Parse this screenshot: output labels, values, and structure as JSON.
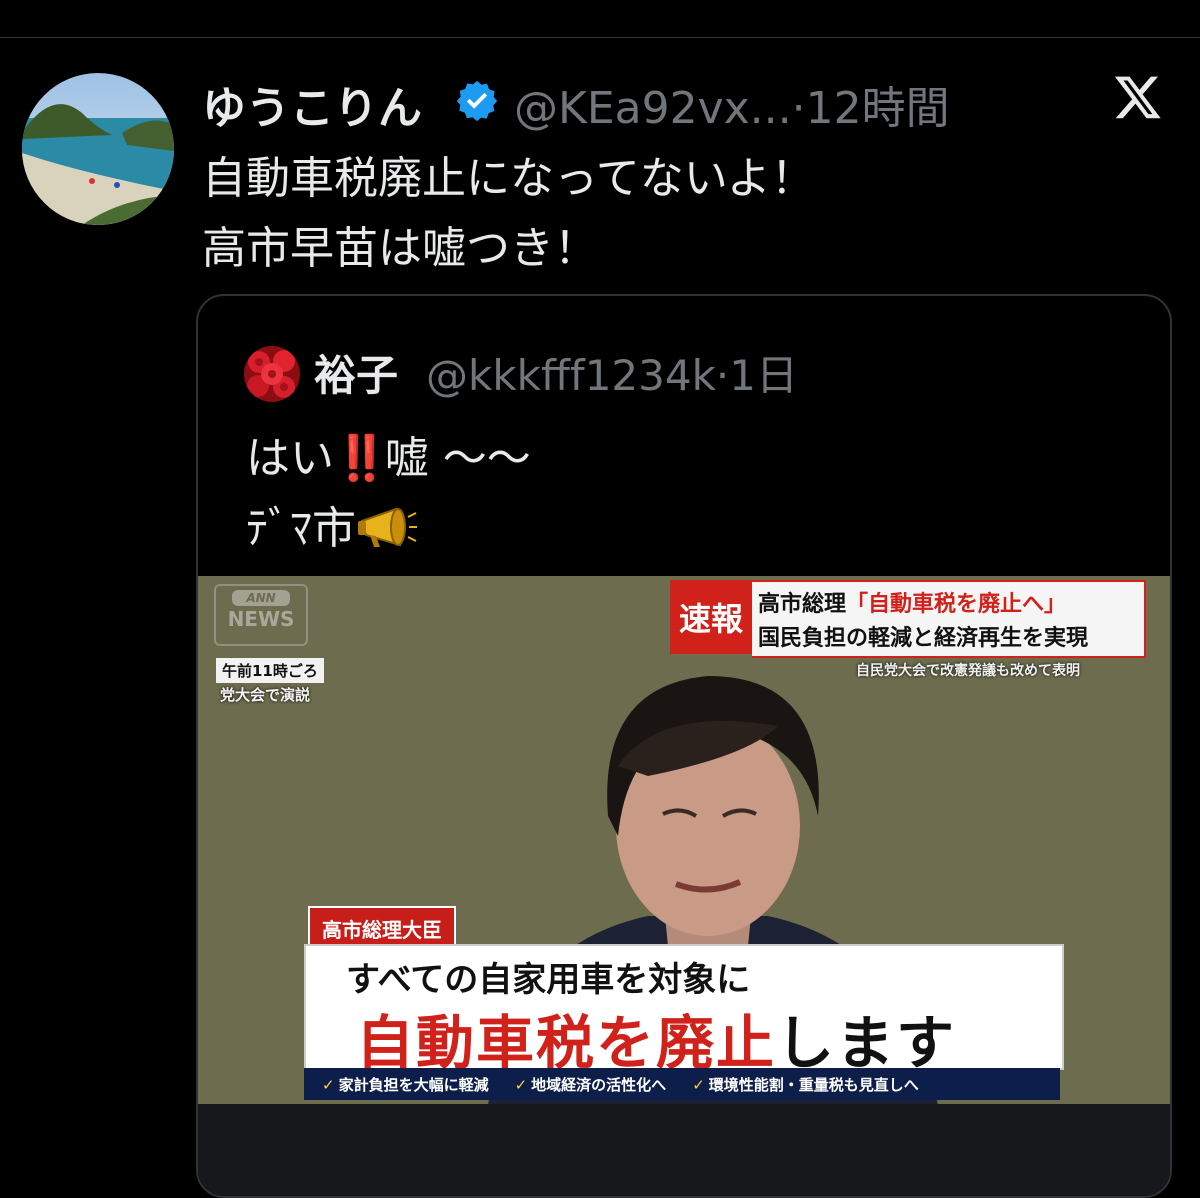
{
  "tweet": {
    "display_name": "ゆうこりん",
    "handle_time": "@KEa92vx...·12時間",
    "text_line1": "自動車税廃止になってないよ！",
    "text_line2": "高市早苗は嘘つき！"
  },
  "quoted": {
    "display_name": "裕子",
    "handle_time": "@kkkfff1234k·1日",
    "text_line1_a": "はい",
    "text_line1_b": "‼️",
    "text_line1_c": "嘘 〜〜",
    "text_line2": "ﾃﾞﾏ市"
  },
  "news_image": {
    "logo_top": "ANN",
    "logo_bottom": "NEWS",
    "time_label": "午前11時ごろ",
    "time_sub": "党大会で演説",
    "breaking": "速報",
    "headline1_a": "高市総理",
    "headline1_b": "「自動車税を廃止へ」",
    "headline2": "国民負担の軽減と経済再生を実現",
    "headline_sub": "自民党大会で改憲発議も改めて表明",
    "speaker_tag": "高市総理大臣",
    "caption1": "すべての自家用車を対象に",
    "caption2_red": "自動車税を廃止",
    "caption2_black": "します",
    "ticker": [
      "家計負担を大幅に軽減",
      "地域経済の活性化へ",
      "環境性能割・重量税も見直しへ"
    ]
  },
  "colors": {
    "background": "#000000",
    "verified": "#1d9bf0",
    "secondary_text": "#71767b",
    "alert_red": "#d0211b"
  },
  "icons": [
    "verified-badge-icon",
    "x-logo-icon",
    "megaphone-icon"
  ]
}
